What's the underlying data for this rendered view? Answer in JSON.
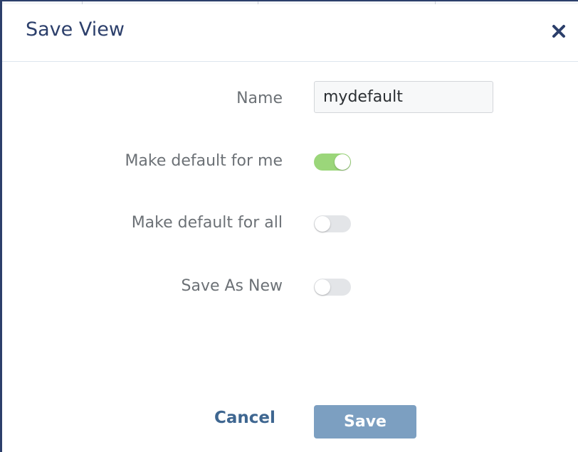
{
  "dialog": {
    "title": "Save View",
    "close_icon": "close-icon"
  },
  "form": {
    "name_label": "Name",
    "name_value": "mydefault",
    "toggles": [
      {
        "label": "Make default for me",
        "checked": true
      },
      {
        "label": "Make default for all",
        "checked": false
      },
      {
        "label": "Save As New",
        "checked": false
      }
    ]
  },
  "buttons": {
    "cancel_label": "Cancel",
    "save_label": "Save"
  },
  "colors": {
    "title": "#2c3f6b",
    "toggle_on": "#9bd67a",
    "toggle_off": "#e3e5e8",
    "save_button": "#7c9fc1",
    "cancel_link": "#3e6690"
  }
}
